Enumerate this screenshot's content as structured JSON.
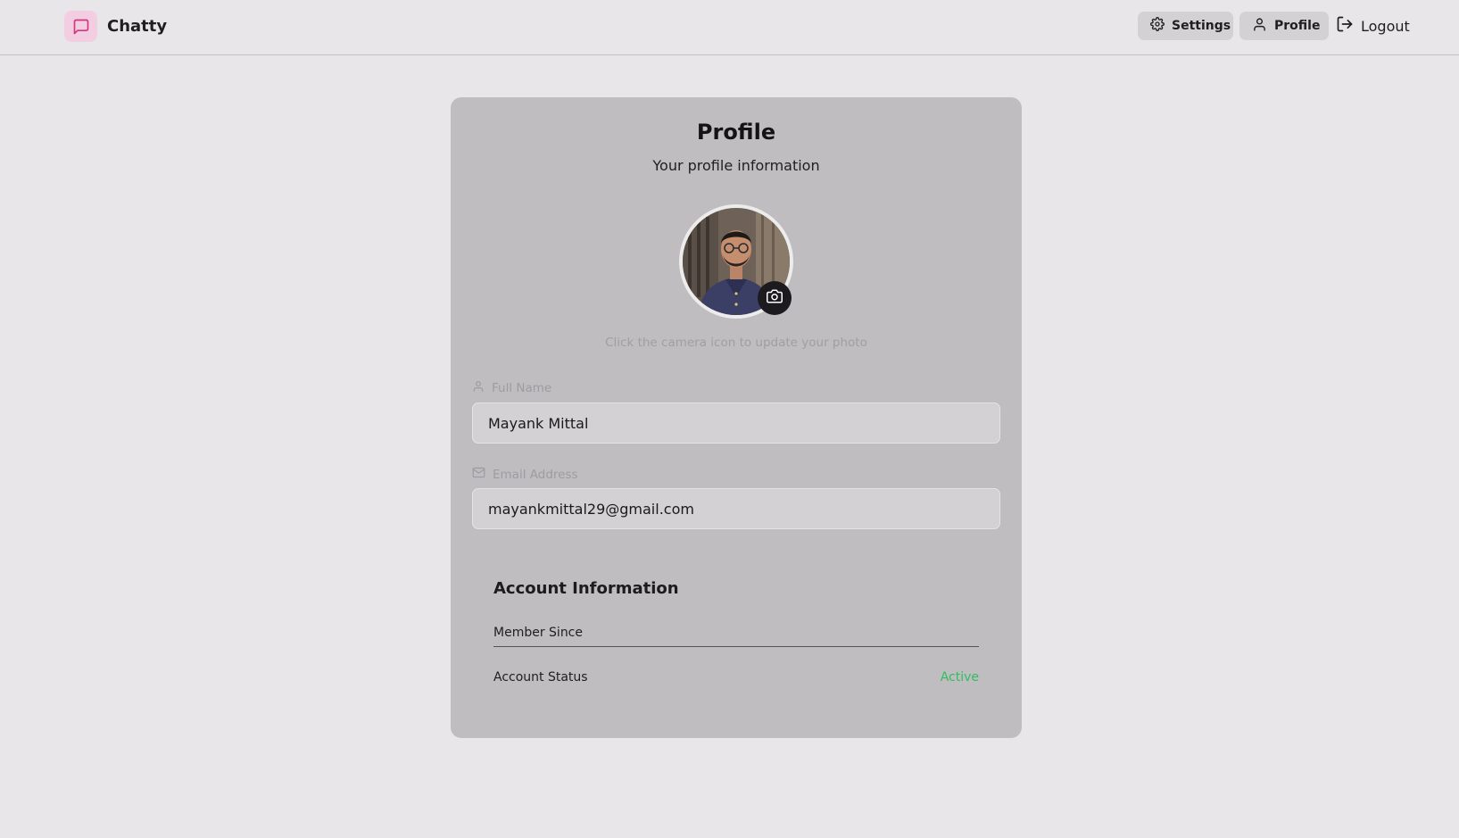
{
  "app": {
    "name": "Chatty",
    "brand_color": "#f3cde1",
    "brand_icon_color": "#d4367f",
    "logo_icon": "message-square-icon"
  },
  "nav": {
    "settings_label": "Settings",
    "settings_icon": "gear-icon",
    "profile_label": "Profile",
    "profile_icon": "user-icon",
    "logout_label": "Logout",
    "logout_icon": "log-out-icon"
  },
  "profile": {
    "title": "Profile",
    "subtitle": "Your profile information",
    "avatar_icon": "camera-icon",
    "hint": "Click the camera icon to update your photo",
    "full_name_label": "Full Name",
    "full_name_value": "Mayank Mittal",
    "email_label": "Email Address",
    "email_value": "mayankmittal29@gmail.com"
  },
  "account": {
    "title": "Account Information",
    "member_since_label": "Member Since",
    "member_since_value": "",
    "status_label": "Account Status",
    "status_value": "Active",
    "status_color": "#2fbf5f"
  }
}
